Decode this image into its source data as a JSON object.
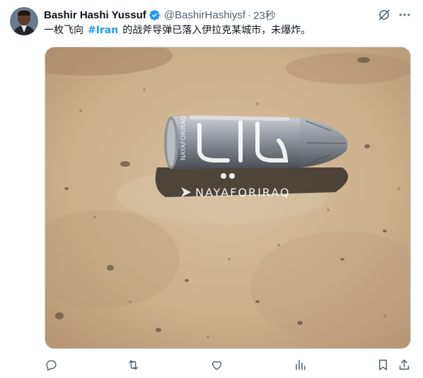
{
  "tweet": {
    "author_name": "Bashir Hashi Yussuf",
    "handle": "@BashirHashiysf",
    "separator": "·",
    "time": "23秒",
    "text_before": "一枚飞向",
    "hashtag": "#Iran",
    "text_after": "的战斧导弹已落入伊拉克某城市，未爆炸。",
    "verified": true
  },
  "media": {
    "watermark_text": "NAYAFORIRAQ",
    "logo_text": "ناي"
  },
  "icons": {
    "verified": "verified-badge-icon",
    "grok": "grok-icon",
    "more": "more-icon",
    "reply": "reply-icon",
    "repost": "repost-icon",
    "like": "like-icon",
    "views": "views-icon",
    "bookmark": "bookmark-icon",
    "share": "share-icon"
  },
  "colors": {
    "accent": "#1d9bf0",
    "text": "#0f1419",
    "secondary": "#536471"
  }
}
